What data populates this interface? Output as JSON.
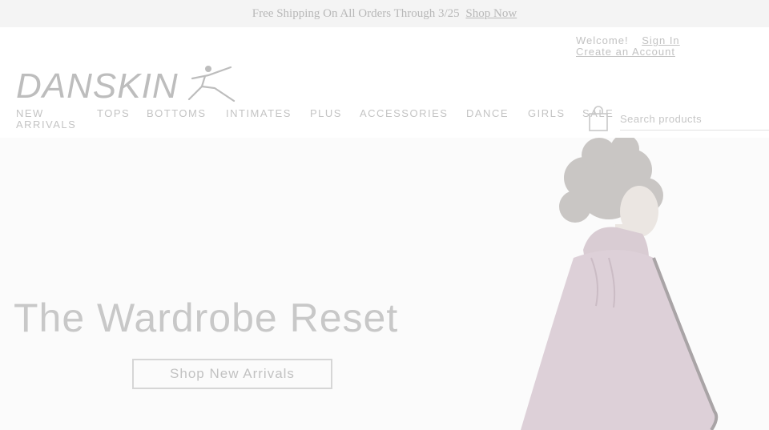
{
  "promo": {
    "text": "Free Shipping On All Orders Through 3/25",
    "link": "Shop Now"
  },
  "account": {
    "welcome": "Welcome!",
    "sign_in": "Sign In",
    "create_account": "Create an Account"
  },
  "brand": {
    "logo_text": "DANSKIN"
  },
  "nav": {
    "items": [
      {
        "label": "NEW ARRIVALS"
      },
      {
        "label": "TOPS"
      },
      {
        "label": "BOTTOMS"
      },
      {
        "label": "INTIMATES"
      },
      {
        "label": "PLUS"
      },
      {
        "label": "ACCESSORIES"
      },
      {
        "label": "DANCE"
      },
      {
        "label": "GIRLS"
      },
      {
        "label": "SALE"
      }
    ]
  },
  "search": {
    "placeholder": "Search products"
  },
  "hero": {
    "headline": "The Wardrobe Reset",
    "cta": "Shop New Arrivals"
  },
  "icons": {
    "cart": "shopping-bag-icon",
    "logo_figure": "leaping-dancer-icon"
  },
  "colors": {
    "promo_bg": "#f4f4f4",
    "text_muted": "#c4c4c4",
    "garment": "#ddd0d8"
  }
}
